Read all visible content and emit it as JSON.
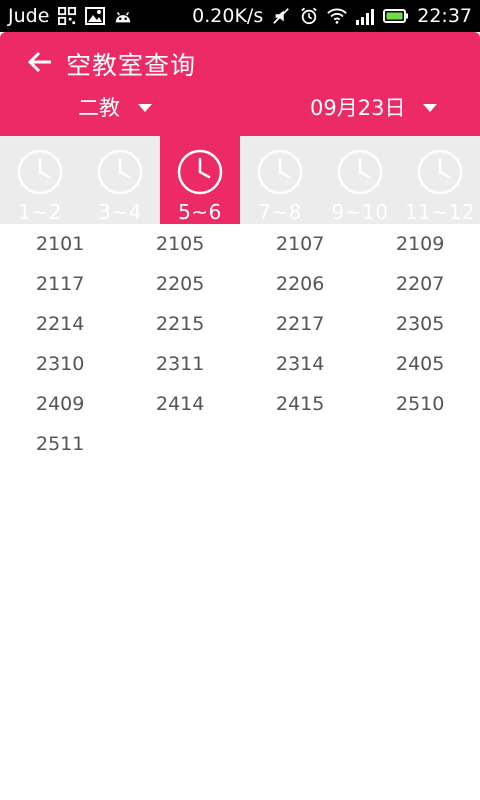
{
  "status_bar": {
    "carrier": "Jude",
    "speed": "0.20K/s",
    "time": "22:37",
    "icons": [
      "qr-icon",
      "image-icon",
      "android-icon",
      "mute-icon",
      "alarm-icon",
      "wifi-icon",
      "signal-icon",
      "battery-icon"
    ]
  },
  "header": {
    "title": "空教室查询",
    "building": "二教",
    "date": "09月23日"
  },
  "periods": [
    {
      "label": "1~2"
    },
    {
      "label": "3~4"
    },
    {
      "label": "5~6"
    },
    {
      "label": "7~8"
    },
    {
      "label": "9~10"
    },
    {
      "label": "11~12"
    }
  ],
  "active_period": "5~6",
  "rooms": [
    "2101",
    "2105",
    "2107",
    "2109",
    "2117",
    "2205",
    "2206",
    "2207",
    "2214",
    "2215",
    "2217",
    "2305",
    "2310",
    "2311",
    "2314",
    "2405",
    "2409",
    "2414",
    "2415",
    "2510",
    "2511"
  ],
  "colors": {
    "accent": "#ec2a66",
    "tab_bg": "#ececec",
    "room_text": "#555555"
  }
}
